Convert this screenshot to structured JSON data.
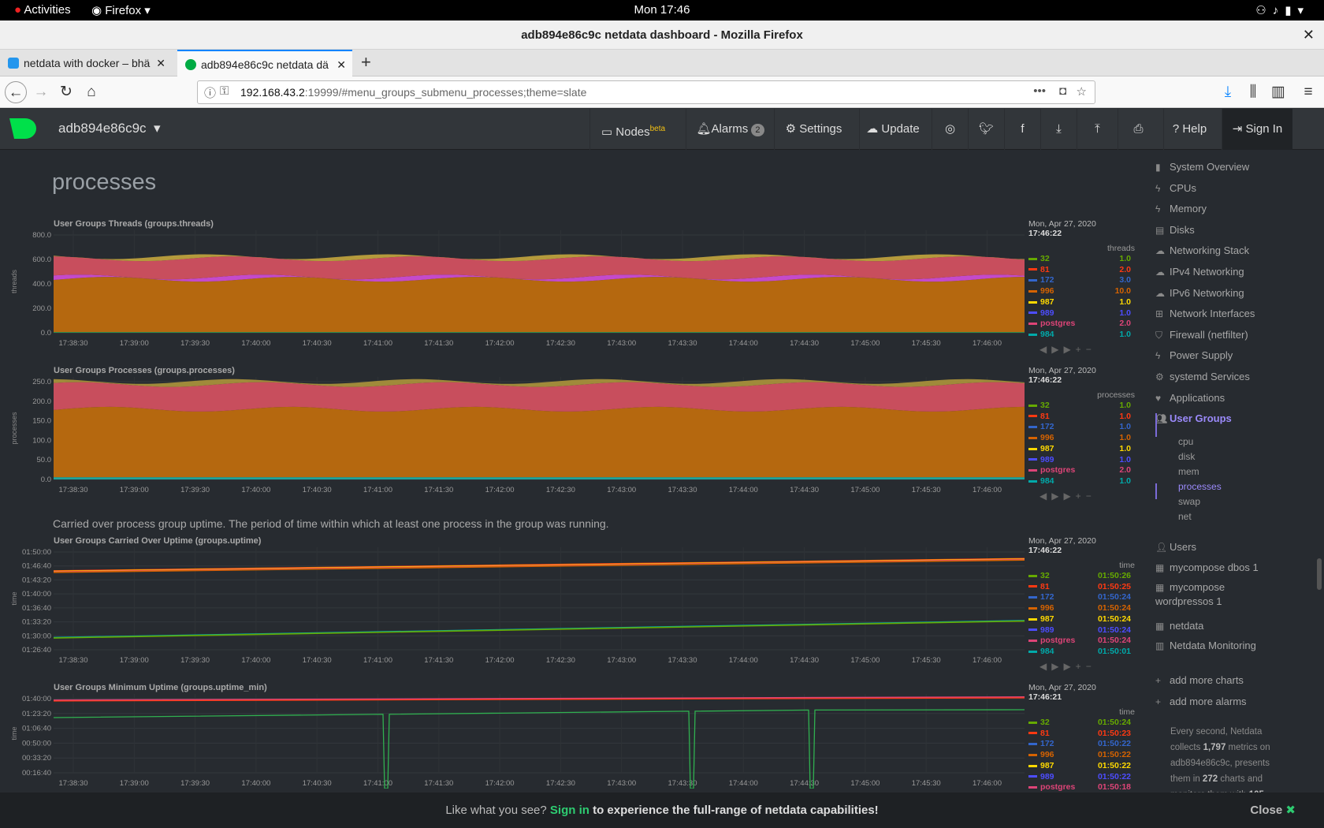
{
  "os": {
    "activities": "Activities",
    "app": "Firefox",
    "clock": "Mon 17:46"
  },
  "window": {
    "title": "adb894e86c9c netdata dashboard - Mozilla Firefox"
  },
  "tabs": [
    {
      "label": "netdata with docker – bhä"
    },
    {
      "label": "adb894e86c9c netdata dä"
    }
  ],
  "url": {
    "host": "192.168.43.2",
    "rest": ":19999/#menu_groups_submenu_processes;theme=slate"
  },
  "netdata": {
    "hostname": "adb894e86c9c",
    "nodes": "Nodes",
    "beta": "beta",
    "alarms": "Alarms",
    "alarm_count": "2",
    "settings": "Settings",
    "update": "Update",
    "help": "Help",
    "signin": "Sign In"
  },
  "section_title": "processes",
  "uptime_description": "Carried over process group uptime. The period of time within which at least one process in the group was running.",
  "xticks": [
    "17:38:30",
    "17:39:00",
    "17:39:30",
    "17:40:00",
    "17:40:30",
    "17:41:00",
    "17:41:30",
    "17:42:00",
    "17:42:30",
    "17:43:00",
    "17:43:30",
    "17:44:00",
    "17:44:30",
    "17:45:00",
    "17:45:30",
    "17:46:00"
  ],
  "legend_names": [
    "32",
    "81",
    "172",
    "996",
    "987",
    "989",
    "postgres",
    "984"
  ],
  "legend_colors": [
    "#66aa00",
    "#fe3912",
    "#3366cc",
    "#d66300",
    "#ffd900",
    "#4d4dff",
    "#dd4477",
    "#00aaaa"
  ],
  "chart_data": [
    {
      "id": "threads",
      "type": "area",
      "title": "User Groups Threads (groups.threads)",
      "ylabel": "threads",
      "units": "threads",
      "date": "Mon, Apr 27, 2020",
      "time": "17:46:22",
      "yticks": [
        "800.0",
        "600.0",
        "400.0",
        "200.0",
        "0.0"
      ],
      "ylim": [
        0,
        900
      ],
      "values": [
        "1.0",
        "2.0",
        "3.0",
        "10.0",
        "1.0",
        "1.0",
        "2.0",
        "1.0"
      ]
    },
    {
      "id": "processes",
      "type": "area",
      "title": "User Groups Processes (groups.processes)",
      "ylabel": "processes",
      "units": "processes",
      "date": "Mon, Apr 27, 2020",
      "time": "17:46:22",
      "yticks": [
        "250.0",
        "200.0",
        "150.0",
        "100.0",
        "50.0",
        "0.0"
      ],
      "ylim": [
        0,
        270
      ],
      "values": [
        "1.0",
        "1.0",
        "1.0",
        "1.0",
        "1.0",
        "1.0",
        "2.0",
        "1.0"
      ]
    },
    {
      "id": "uptime",
      "type": "line",
      "title": "User Groups Carried Over Uptime (groups.uptime)",
      "ylabel": "time",
      "units": "time",
      "date": "Mon, Apr 27, 2020",
      "time": "17:46:22",
      "yticks": [
        "01:50:00",
        "01:46:40",
        "01:43:20",
        "01:40:00",
        "01:36:40",
        "01:33:20",
        "01:30:00",
        "01:26:40"
      ],
      "values": [
        "01:50:26",
        "01:50:25",
        "01:50:24",
        "01:50:24",
        "01:50:24",
        "01:50:24",
        "01:50:24",
        "01:50:01"
      ]
    },
    {
      "id": "uptime_min",
      "type": "line",
      "title": "User Groups Minimum Uptime (groups.uptime_min)",
      "ylabel": "time",
      "units": "time",
      "date": "Mon, Apr 27, 2020",
      "time": "17:46:21",
      "yticks": [
        "01:40:00",
        "01:23:20",
        "01:06:40",
        "00:50:00",
        "00:33:20",
        "00:16:40"
      ],
      "values": [
        "01:50:24",
        "01:50:23",
        "01:50:22",
        "01:50:22",
        "01:50:22",
        "01:50:22",
        "01:50:18"
      ]
    }
  ],
  "sidebar": {
    "items": [
      "System Overview",
      "CPUs",
      "Memory",
      "Disks",
      "Networking Stack",
      "IPv4 Networking",
      "IPv6 Networking",
      "Network Interfaces",
      "Firewall (netfilter)",
      "Power Supply",
      "systemd Services",
      "Applications",
      "User Groups"
    ],
    "subitems": [
      "cpu",
      "disk",
      "mem",
      "processes",
      "swap",
      "net"
    ],
    "items2": [
      "Users",
      "mycompose dbos 1",
      "mycompose",
      "netdata",
      "Netdata Monitoring"
    ],
    "items2_cont": "wordpressos 1",
    "add_charts": "add more charts",
    "add_alarms": "add more alarms",
    "info1": "Every second, Netdata collects",
    "metrics": "1,797",
    "info2": "metrics on",
    "host": "adb894e86c9c,",
    "info3": "presents them in",
    "charts": "272",
    "info4": "charts and",
    "info5": "monitors them with",
    "alarms_n": "105"
  },
  "banner": {
    "pre": "Like what you see?",
    "link": "Sign in",
    "post": "to experience the full-range of netdata capabilities!",
    "close": "Close"
  }
}
